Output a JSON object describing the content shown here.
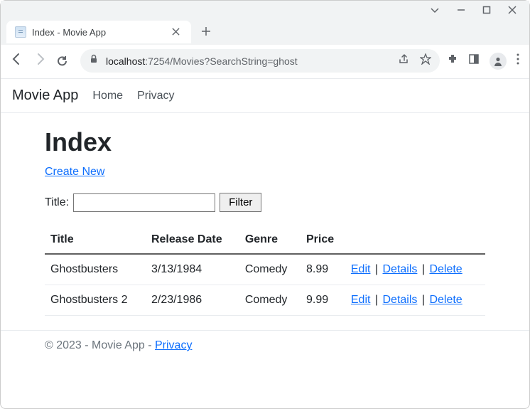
{
  "browser": {
    "tab_title": "Index - Movie App",
    "url_host": "localhost",
    "url_path": ":7254/Movies?SearchString=ghost"
  },
  "navbar": {
    "brand": "Movie App",
    "links": [
      "Home",
      "Privacy"
    ]
  },
  "page": {
    "heading": "Index",
    "create_link": "Create New",
    "search_label": "Title:",
    "search_value": "",
    "filter_button": "Filter"
  },
  "table": {
    "columns": [
      "Title",
      "Release Date",
      "Genre",
      "Price",
      ""
    ],
    "rows": [
      {
        "title": "Ghostbusters",
        "release_date": "3/13/1984",
        "genre": "Comedy",
        "price": "8.99"
      },
      {
        "title": "Ghostbusters 2",
        "release_date": "2/23/1986",
        "genre": "Comedy",
        "price": "9.99"
      }
    ],
    "actions": {
      "edit": "Edit",
      "details": "Details",
      "delete": "Delete"
    }
  },
  "footer": {
    "text": "© 2023 - Movie App - ",
    "link": "Privacy"
  }
}
